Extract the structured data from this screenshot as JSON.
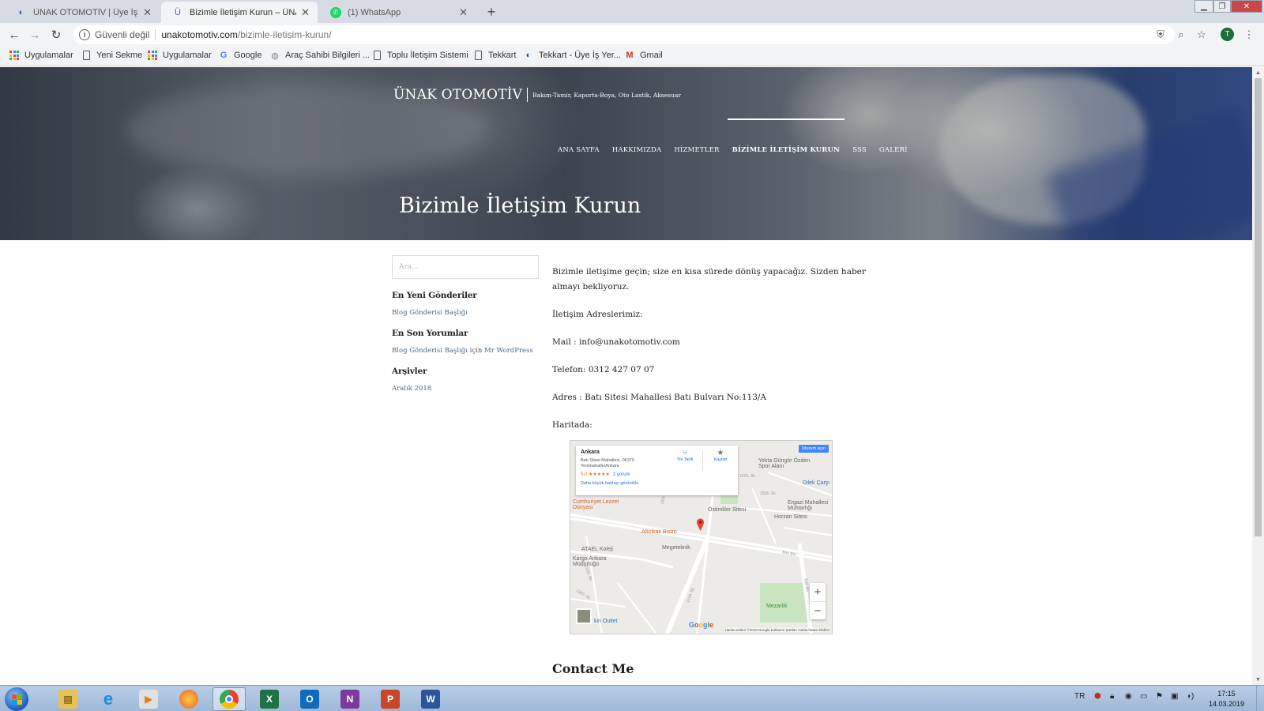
{
  "browser": {
    "tabs": [
      {
        "title": "ÜNAK OTOMOTİV | Üye İş Yeri B",
        "active": false
      },
      {
        "title": "Bizimle İletişim Kurun – ÜNAK OT",
        "active": true
      },
      {
        "title": "(1) WhatsApp",
        "active": false
      }
    ],
    "security_label": "Güvenli değil",
    "url_host": "unakotomotiv.com",
    "url_path": "/bizimle-iletisim-kurun/",
    "profile_initial": "T",
    "bookmarks": [
      {
        "label": "Uygulamalar",
        "icon": "apps-icon"
      },
      {
        "label": "Yeni Sekme",
        "icon": "page-icon"
      },
      {
        "label": "Uygulamalar",
        "icon": "apps-icon"
      },
      {
        "label": "Google",
        "icon": "google-icon"
      },
      {
        "label": "Araç Sahibi Bilgileri ...",
        "icon": "globe-icon"
      },
      {
        "label": "Toplu İletişim Sistemi",
        "icon": "page-icon"
      },
      {
        "label": "Tekkart",
        "icon": "page-icon"
      },
      {
        "label": "Tekkart - Üye İş Yer...",
        "icon": "tekkart-icon"
      },
      {
        "label": "Gmail",
        "icon": "gmail-icon"
      }
    ]
  },
  "site": {
    "brand": "ÜNAK OTOMOTİV",
    "tagline": "Bakım-Tamir, Kaporta-Boya, Oto Lastik, Aksesuar",
    "nav": [
      {
        "label": "ANA SAYFA",
        "active": false
      },
      {
        "label": "HAKKIMIZDA",
        "active": false
      },
      {
        "label": "HİZMETLER",
        "active": false
      },
      {
        "label": "BİZİMLE İLETİŞİM KURUN",
        "active": true
      },
      {
        "label": "SSS",
        "active": false
      },
      {
        "label": "GALERİ",
        "active": false
      }
    ],
    "page_title": "Bizimle İletişim Kurun"
  },
  "sidebar": {
    "search_placeholder": "Ara...",
    "recent_posts_title": "En Yeni Gönderiler",
    "recent_post": "Blog Gönderisi Başlığı",
    "recent_comments_title": "En Son Yorumlar",
    "comment_post": "Blog Gönderisi Başlığı",
    "comment_connector": " için ",
    "comment_author": "Mr WordPress",
    "archives_title": "Arşivler",
    "archive_item": "Aralık 2018"
  },
  "content": {
    "intro": "Bizimle iletişime geçin; size en kısa sürede dönüş yapacağız.  Sizden haber almayı bekliyoruz.",
    "addresses_label": "İletişim Adreslerimiz:",
    "mail": "Mail : info@unakotomotiv.com",
    "phone": "Telefon: 0312 427 07 07",
    "address": "Adres : Batı Sitesi Mahallesi Batı Bulvarı No:113/A",
    "map_label": "Haritada:",
    "contact_heading": "Contact Me"
  },
  "map": {
    "card_title": "Ankara",
    "card_address": "Batı Sitesi Mahallesi, 06370 Yenimahalle/Ankara",
    "rating": "5,0 ★★★★★",
    "reviews": "2 yorum",
    "larger_map": "Daha büyük haritayı görüntüle",
    "directions": "Yol Tarifi",
    "save": "Kaydet",
    "signin": "Oturum açın",
    "pois": [
      {
        "label": "Yekta Güngör Özden Spor Alanı",
        "color": "gray"
      },
      {
        "label": "Dilek Çarşı",
        "color": "blue"
      },
      {
        "label": "Ergazi Mahallesi Muhtarlığı",
        "color": "gray"
      },
      {
        "label": "Ostimliler Sitesi",
        "color": "gray"
      },
      {
        "label": "Horzan Sitesi",
        "color": "gray"
      },
      {
        "label": "Cumhuriyet Lezzet Dünyası",
        "color": "orange"
      },
      {
        "label": "Altınkak Bistro",
        "color": "orange"
      },
      {
        "label": "Megeteknik",
        "color": "gray"
      },
      {
        "label": "ATAEL Koleji",
        "color": "gray"
      },
      {
        "label": "Kargo Ankara Müdürlüğü",
        "color": "gray"
      },
      {
        "label": "Mezarlık",
        "color": "green"
      },
      {
        "label": "kin Outlet",
        "color": "blue"
      }
    ],
    "streets": [
      "Batı Blv.",
      "1524. Sk.",
      "1536. Sk.",
      "1518. Sk.",
      "2256. Sk.",
      "2300. Sk.",
      "1828",
      "Batı Blv"
    ],
    "google": "Google",
    "attribution": "Harita verileri ©2019 Google   Kullanım Şartları   Harita hatası bildirin"
  },
  "taskbar": {
    "language": "TR",
    "time": "17:15",
    "date": "14.03.2019"
  }
}
